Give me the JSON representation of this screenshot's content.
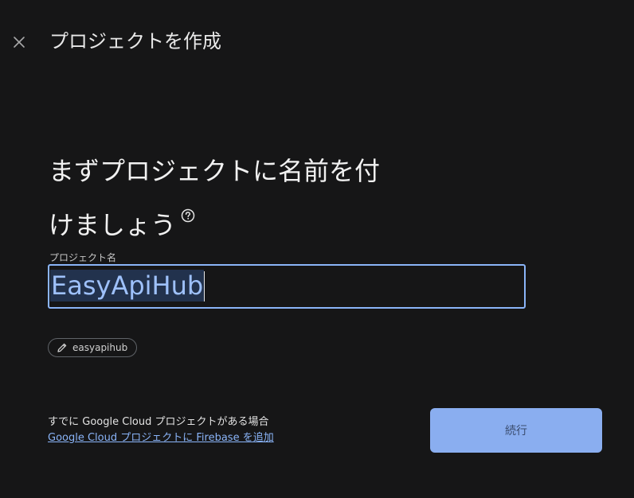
{
  "header": {
    "title": "プロジェクトを作成",
    "close_icon": "close-icon"
  },
  "main": {
    "heading_line1": "まずプロジェクトに名前を付",
    "heading_line2": "けましょう",
    "help_icon": "help-circle-icon"
  },
  "project_name_field": {
    "label": "プロジェクト名",
    "value": "EasyApiHub"
  },
  "project_id_chip": {
    "icon": "pencil-icon",
    "label": "easyapihub"
  },
  "footer": {
    "note": "すでに Google Cloud プロジェクトがある場合",
    "link": "Google Cloud プロジェクトに Firebase を追加"
  },
  "actions": {
    "continue_label": "続行",
    "continue_color": "#8aaef0"
  },
  "colors": {
    "background": "#161617",
    "accent": "#8ab4f8"
  }
}
